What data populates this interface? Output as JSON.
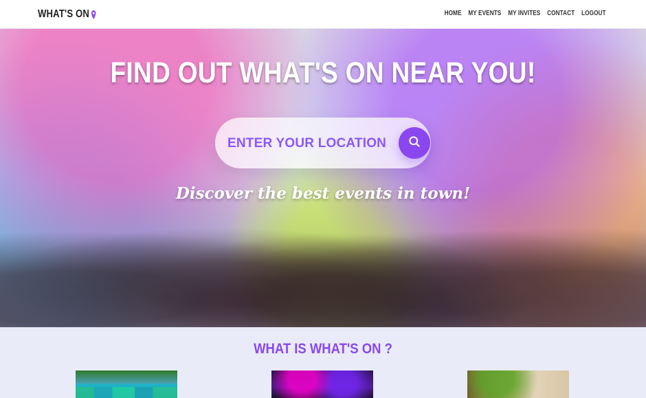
{
  "brand": {
    "name": "WHAT'S ON",
    "pin_color": "#8a47f0",
    "pin_icon": "location-pin-icon"
  },
  "nav": {
    "items": [
      "HOME",
      "MY EVENTS",
      "MY INVITES",
      "CONTACT",
      "LOGOUT"
    ]
  },
  "hero": {
    "title": "FIND OUT WHAT'S ON NEAR YOU!",
    "search": {
      "placeholder": "ENTER YOUR LOCATION",
      "value": "",
      "button_icon": "search-icon"
    },
    "tagline": "Discover the best events in town!"
  },
  "about": {
    "title": "WHAT IS WHAT'S ON ?"
  },
  "colors": {
    "accent": "#8a47f0",
    "background": "#e9ebf8",
    "nav_bg": "#ffffff"
  }
}
